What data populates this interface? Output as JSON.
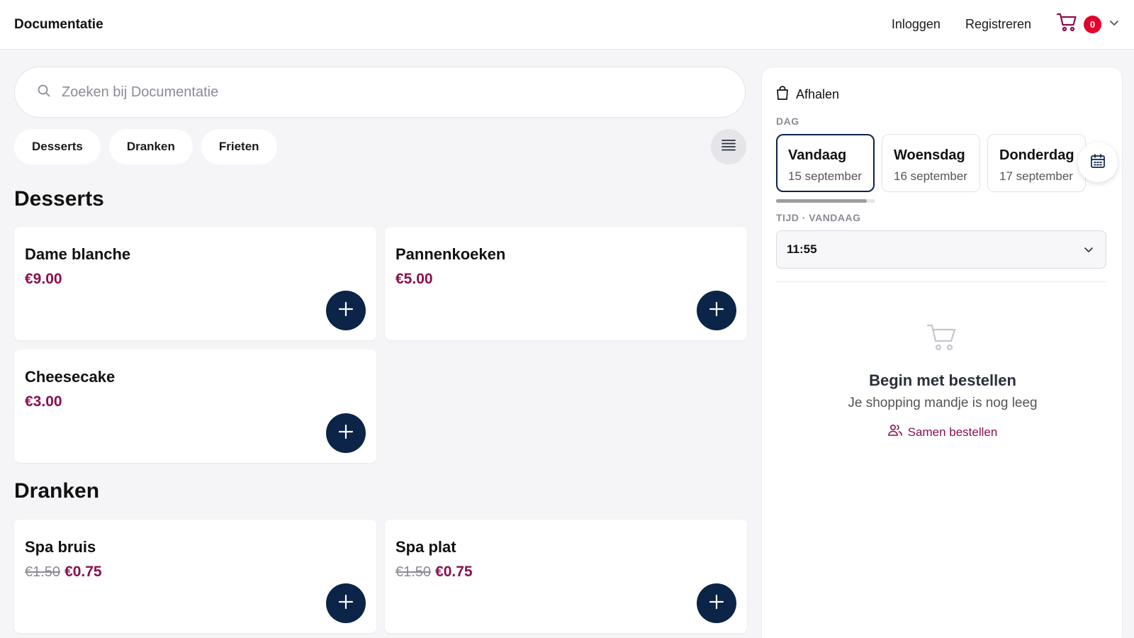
{
  "header": {
    "brand": "Documentatie",
    "login": "Inloggen",
    "register": "Registreren",
    "cart_count": "0",
    "icons": [
      "cart-icon",
      "chevron-down-icon"
    ]
  },
  "search": {
    "placeholder": "Zoeken bij Documentatie",
    "icon": "search-icon"
  },
  "categories": [
    "Desserts",
    "Dranken",
    "Frieten"
  ],
  "sections": [
    {
      "title": "Desserts",
      "items": [
        {
          "name": "Dame blanche",
          "price": "€9.00"
        },
        {
          "name": "Pannenkoeken",
          "price": "€5.00"
        },
        {
          "name": "Cheesecake",
          "price": "€3.00"
        }
      ]
    },
    {
      "title": "Dranken",
      "items": [
        {
          "name": "Spa bruis",
          "old_price": "€1.50",
          "price": "€0.75"
        },
        {
          "name": "Spa plat",
          "old_price": "€1.50",
          "price": "€0.75"
        }
      ]
    }
  ],
  "order_panel": {
    "mode": "Afhalen",
    "day_label": "DAG",
    "days": [
      {
        "name": "Vandaag",
        "date": "15 september",
        "selected": true
      },
      {
        "name": "Woensdag",
        "date": "16 september",
        "selected": false
      },
      {
        "name": "Donderdag",
        "date": "17 september",
        "selected": false
      }
    ],
    "time_label": "TIJD · VANDAAG",
    "time_value": "11:55",
    "empty_title": "Begin met bestellen",
    "empty_subtitle": "Je shopping mandje is nog leeg",
    "order_together": "Samen bestellen"
  },
  "colors": {
    "accent": "#8a0f4f",
    "button": "#0b2448",
    "badge": "#e3002a",
    "background": "#f5f5f7"
  }
}
